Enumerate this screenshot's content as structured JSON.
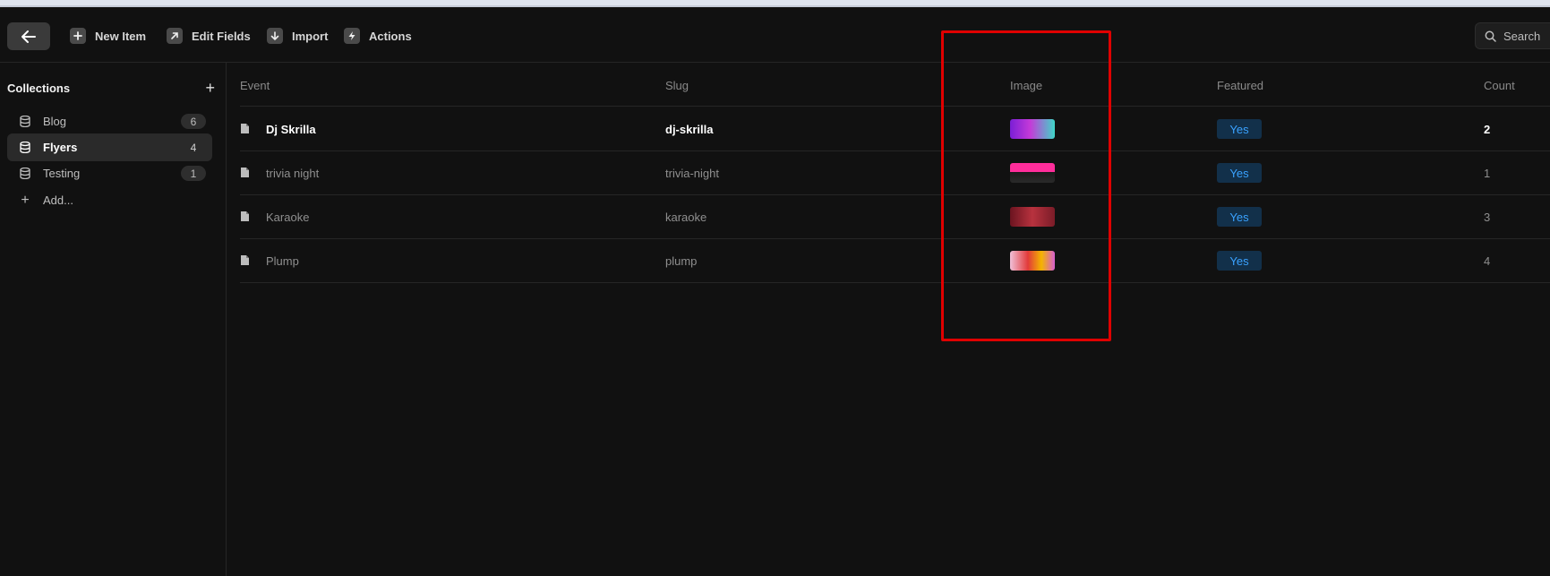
{
  "toolbar": {
    "new_item_label": "New Item",
    "edit_fields_label": "Edit Fields",
    "import_label": "Import",
    "actions_label": "Actions",
    "search_placeholder": "Search"
  },
  "sidebar": {
    "title": "Collections",
    "items": [
      {
        "label": "Blog",
        "count": "6"
      },
      {
        "label": "Flyers",
        "count": "4",
        "active": true
      },
      {
        "label": "Testing",
        "count": "1"
      }
    ],
    "add_label": "Add..."
  },
  "table": {
    "columns": [
      "Event",
      "Slug",
      "Image",
      "Featured",
      "Count"
    ],
    "rows": [
      {
        "event": "Dj Skrilla",
        "slug": "dj-skrilla",
        "image": "Dj Skrilla flyer thumbnail",
        "featured": "Yes",
        "count": "2"
      },
      {
        "event": "trivia night",
        "slug": "trivia-night",
        "image": "Trivia flyer thumbnail",
        "featured": "Yes",
        "count": "1"
      },
      {
        "event": "Karaoke",
        "slug": "karaoke",
        "image": "Karaoke flyer thumbnail",
        "featured": "Yes",
        "count": "3"
      },
      {
        "event": "Plump",
        "slug": "plump",
        "image": "Plump flyer thumbnail",
        "featured": "Yes",
        "count": "4"
      }
    ]
  },
  "colors": {
    "background": "#111111",
    "badge_bg": "#12304a",
    "badge_text": "#3aa2ff",
    "highlight": "#e00000"
  }
}
